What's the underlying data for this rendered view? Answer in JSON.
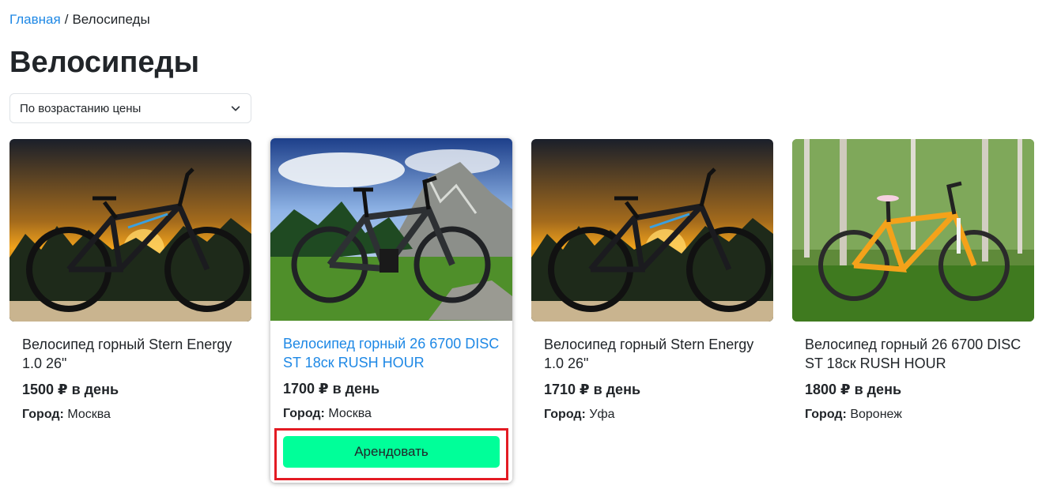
{
  "breadcrumb": {
    "home": "Главная",
    "separator": "/",
    "current": "Велосипеды"
  },
  "page_title": "Велосипеды",
  "sort": {
    "selected": "По возрастанию цены"
  },
  "city_label": "Город:",
  "products": [
    {
      "name": "Велосипед горный Stern Energy 1.0 26\"",
      "price": "1500 ₽ в день",
      "city": "Москва"
    },
    {
      "name": "Велосипед горный 26 6700 DISC ST 18ск RUSH HOUR",
      "price": "1700 ₽ в день",
      "city": "Москва",
      "button": "Арендовать"
    },
    {
      "name": "Велосипед горный Stern Energy 1.0 26\"",
      "price": "1710 ₽ в день",
      "city": "Уфа"
    },
    {
      "name": "Велосипед горный 26 6700 DISC ST 18ск RUSH HOUR",
      "price": "1800 ₽ в день",
      "city": "Воронеж"
    }
  ],
  "colors": {
    "link": "#1e88e5",
    "rent_button": "#00ff99",
    "highlight_border": "#e31b23"
  }
}
